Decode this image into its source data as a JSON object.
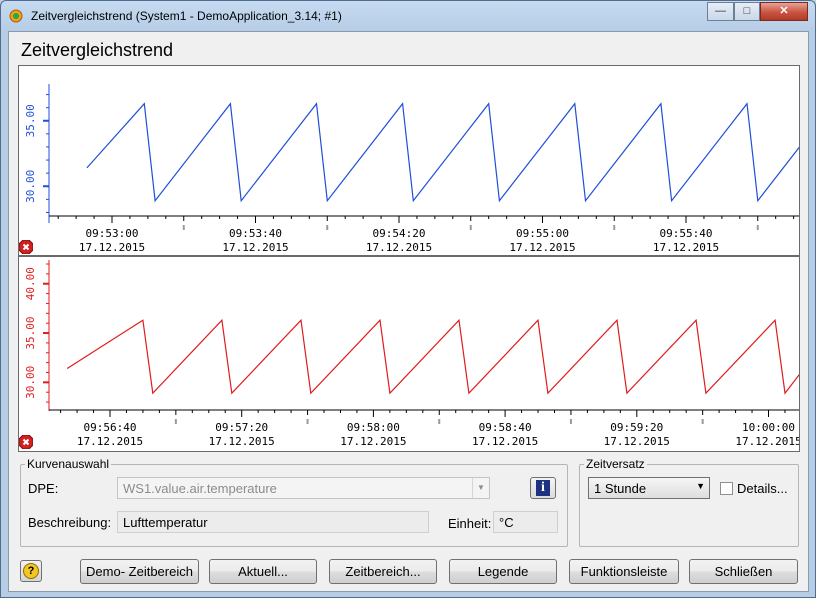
{
  "window": {
    "title": "Zeitvergleichstrend (System1 - DemoApplication_3.14; #1)",
    "minimize": "—",
    "maximize": "□",
    "close": "✕"
  },
  "page_title": "Zeitvergleichstrend",
  "colors": {
    "trend1": "#1f4fd8",
    "trend2": "#e01b1b",
    "error_icon": "#d02020"
  },
  "trend1": {
    "y_ticks": [
      "30.00",
      "35.00"
    ],
    "time_labels": [
      "09:53:00",
      "09:53:40",
      "09:54:20",
      "09:55:00",
      "09:55:40"
    ],
    "date_label": "17.12.2015",
    "error_icon": "error-icon"
  },
  "trend2": {
    "y_ticks": [
      "30.00",
      "35.00",
      "40.00"
    ],
    "time_labels": [
      "09:56:40",
      "09:57:20",
      "09:58:00",
      "09:58:40",
      "09:59:20",
      "10:00:00"
    ],
    "date_label": "17.12.2015",
    "error_icon": "error-icon"
  },
  "chart_data": [
    {
      "type": "line",
      "series": [
        {
          "values": [
            31.4,
            36.3,
            28.9,
            36.3,
            28.9,
            36.3,
            28.9,
            36.3,
            28.9,
            36.3,
            28.9,
            36.3,
            28.9,
            36.3,
            28.9,
            36.3,
            28.9,
            36.3,
            28.9
          ]
        }
      ],
      "x": [
        "09:52:53",
        "09:53:09",
        "09:53:12",
        "09:53:33",
        "09:53:36",
        "09:53:57",
        "09:54:00",
        "09:54:21",
        "09:54:24",
        "09:54:45",
        "09:54:48",
        "09:55:09",
        "09:55:12",
        "09:55:33",
        "09:55:36",
        "09:55:57",
        "09:56:00",
        "09:56:21",
        "09:56:24"
      ],
      "ylim": [
        27.5,
        37.5
      ]
    },
    {
      "type": "line",
      "series": [
        {
          "values": [
            31.4,
            36.3,
            28.9,
            36.3,
            28.9,
            36.3,
            28.9,
            36.3,
            28.9,
            36.3,
            28.9,
            36.3,
            28.9,
            36.3,
            28.9,
            36.3,
            28.9,
            36.3,
            28.9,
            35.4
          ]
        }
      ],
      "x": [
        "09:56:27",
        "09:56:50",
        "09:56:53",
        "09:57:14",
        "09:57:17",
        "09:57:38",
        "09:57:41",
        "09:58:02",
        "09:58:05",
        "09:58:26",
        "09:58:29",
        "09:58:50",
        "09:58:53",
        "09:59:14",
        "09:59:17",
        "09:59:38",
        "09:59:41",
        "10:00:02",
        "10:00:05",
        "10:00:20"
      ],
      "ylim": [
        27.5,
        42.0
      ]
    }
  ],
  "kurvenauswahl": {
    "legend": "Kurvenauswahl",
    "dpe_label": "DPE:",
    "dpe_value": "WS1.value.air.temperature",
    "info_label": "i",
    "beschreibung_label": "Beschreibung:",
    "beschreibung_value": "Lufttemperatur",
    "einheit_label": "Einheit:",
    "einheit_value": "°C"
  },
  "zeitversatz": {
    "legend": "Zeitversatz",
    "selected": "1 Stunde",
    "details_label": "Details...",
    "details_checked": false
  },
  "buttons": {
    "help": "?",
    "demo": "Demo- Zeitbereich",
    "aktuell": "Aktuell...",
    "zeitbereich": "Zeitbereich...",
    "legende": "Legende",
    "funktionsleiste": "Funktionsleiste",
    "schliessen": "Schließen"
  }
}
